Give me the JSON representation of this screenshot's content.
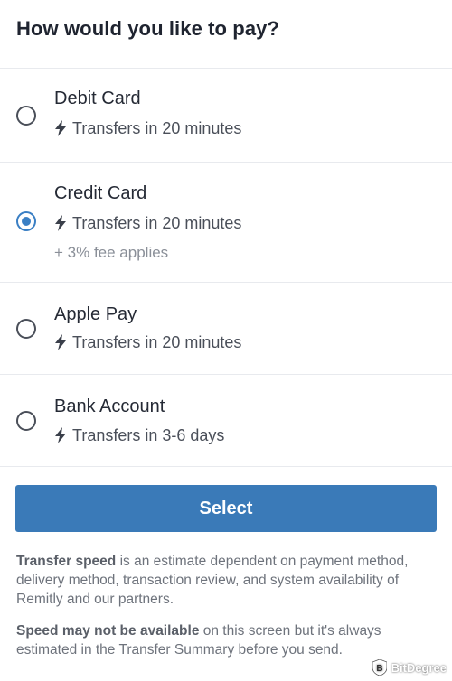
{
  "header": {
    "title": "How would you like to pay?"
  },
  "options": [
    {
      "title": "Debit Card",
      "speed": "Transfers in 20 minutes",
      "fee": "",
      "selected": false
    },
    {
      "title": "Credit Card",
      "speed": "Transfers in 20 minutes",
      "fee": "+ 3% fee applies",
      "selected": true
    },
    {
      "title": "Apple Pay",
      "speed": "Transfers in 20 minutes",
      "fee": "",
      "selected": false
    },
    {
      "title": "Bank Account",
      "speed": "Transfers in 3-6 days",
      "fee": "",
      "selected": false
    }
  ],
  "select_button": {
    "label": "Select"
  },
  "footer": {
    "p1_bold": "Transfer speed",
    "p1_rest": " is an estimate dependent on payment method, delivery method, transaction review, and system availability of Remitly and our partners.",
    "p2_bold": "Speed may not be available",
    "p2_rest": " on this screen but it's always estimated in the Transfer Summary before you send."
  },
  "watermark": {
    "text": "BitDegree"
  },
  "colors": {
    "accent": "#3a7ab8",
    "radio_selected": "#3a7fc4"
  },
  "icons": {
    "speed": "lightning-bolt-icon",
    "watermark": "bitdegree-shield-icon"
  }
}
